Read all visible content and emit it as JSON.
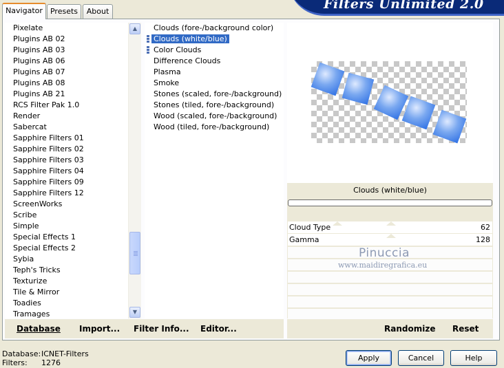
{
  "tabs": [
    {
      "label": "Navigator",
      "active": true
    },
    {
      "label": "Presets",
      "active": false
    },
    {
      "label": "About",
      "active": false
    }
  ],
  "banner_title": "Filters Unlimited 2.0",
  "categories": {
    "items": [
      "Pixelate",
      "Plugins AB 02",
      "Plugins AB 03",
      "Plugins AB 06",
      "Plugins AB 07",
      "Plugins AB 08",
      "Plugins AB 21",
      "RCS Filter Pak 1.0",
      "Render",
      "Sabercat",
      "Sapphire Filters 01",
      "Sapphire Filters 02",
      "Sapphire Filters 03",
      "Sapphire Filters 04",
      "Sapphire Filters 09",
      "Sapphire Filters 12",
      "ScreenWorks",
      "Scribe",
      "Simple",
      "Special Effects 1",
      "Special Effects 2",
      "Sybia",
      "Teph's Tricks",
      "Texturize",
      "Tile & Mirror",
      "Toadies",
      "Tramages"
    ],
    "selected": "Render",
    "scroll_up_icon": "triangle-up",
    "scroll_down_icon": "triangle-down"
  },
  "filters": {
    "items": [
      "Clouds (fore-/background color)",
      "Clouds (white/blue)",
      "Color Clouds",
      "Difference Clouds",
      "Plasma",
      "Smoke",
      "Stones (scaled, fore-/background)",
      "Stones (tiled, fore-/background)",
      "Wood (scaled, fore-/background)",
      "Wood (tiled, fore-/background)"
    ],
    "selected": "Clouds (white/blue)"
  },
  "preview": {
    "label": "Clouds (white/blue)",
    "cloud_color": "#3d7ee8"
  },
  "params": [
    {
      "name": "Cloud Type",
      "value": "62"
    },
    {
      "name": "Gamma",
      "value": "128"
    }
  ],
  "watermark": {
    "name": "Pinuccia",
    "url": "www.maidiregrafica.eu"
  },
  "toolbar": {
    "database": "Database",
    "import": "Import...",
    "filter_info": "Filter Info...",
    "editor": "Editor...",
    "randomize": "Randomize",
    "reset": "Reset"
  },
  "status": {
    "database_label": "Database:",
    "database_value": "ICNET-Filters",
    "filters_label": "Filters:",
    "filters_value": "1276"
  },
  "buttons": {
    "apply": "Apply",
    "cancel": "Cancel",
    "help": "Help"
  },
  "colors": {
    "selection": "#316ac5",
    "banner": "#0a2a78",
    "tab_accent": "#e68b2c"
  }
}
